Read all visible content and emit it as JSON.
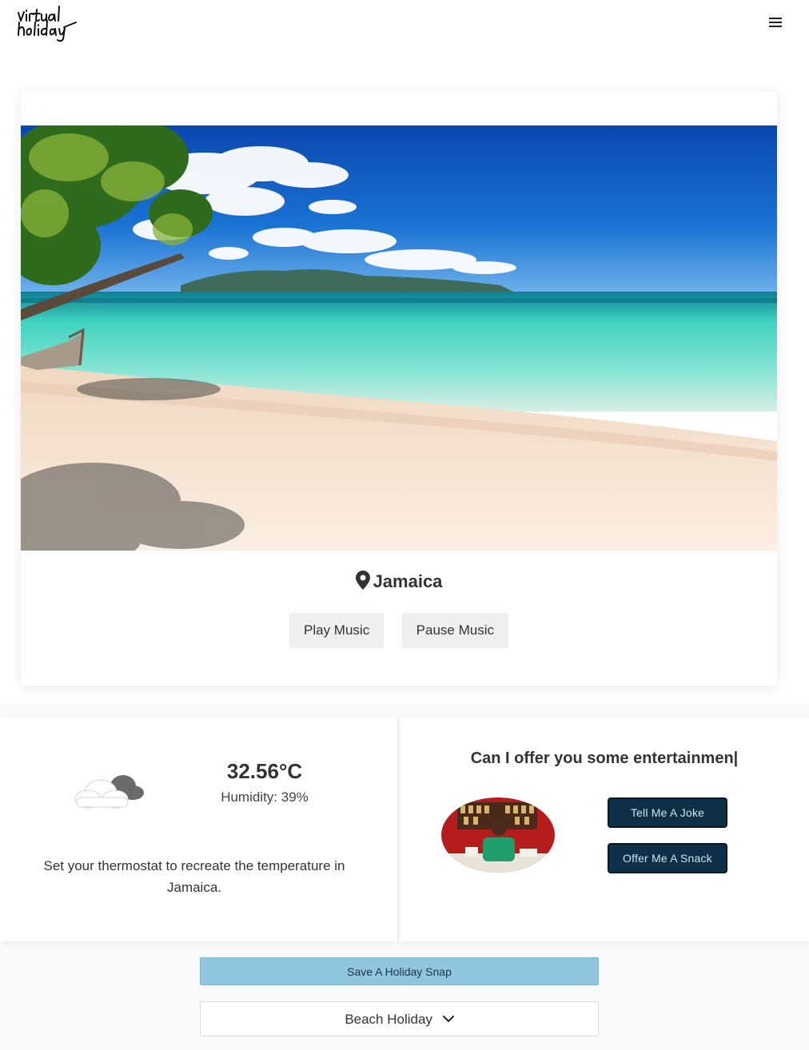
{
  "header": {
    "logo_text": "virtual holiday",
    "menu_icon": "hamburger-menu-icon"
  },
  "destination": {
    "location_icon": "map-pin-icon",
    "location": "Jamaica",
    "play_label": "Play Music",
    "pause_label": "Pause Music"
  },
  "weather": {
    "icon": "cloudy-icon",
    "temperature": "32.56°C",
    "humidity": "Humidity: 39%",
    "thermostat_text": "Set your thermostat to recreate the temperature in Jamaica."
  },
  "entertainment": {
    "title": "Can I offer you some entertainmen|",
    "joke_label": "Tell Me A Joke",
    "snack_label": "Offer Me A Snack"
  },
  "actions": {
    "snap_label": "Save A Holiday Snap",
    "holiday_type": "Beach Holiday",
    "holiday_icon": "chevron-down-icon"
  },
  "colors": {
    "dark_button": "#0d3046",
    "snap_button": "#90c6e0",
    "sea": "#3fd3bf",
    "sky": "#0a5bc4"
  }
}
